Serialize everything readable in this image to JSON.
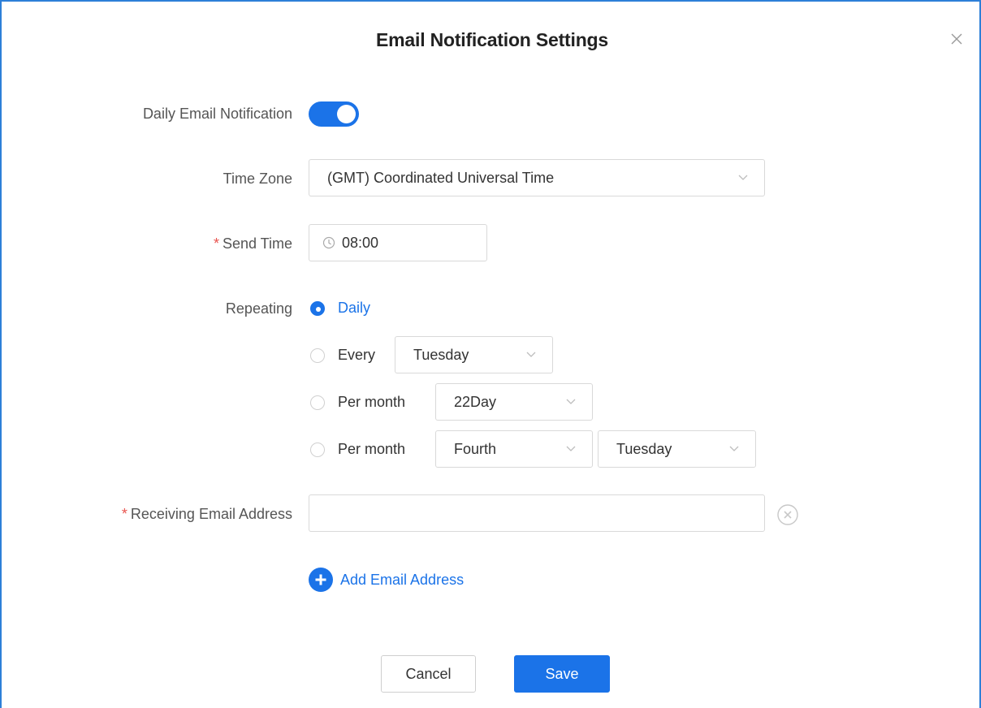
{
  "dialog": {
    "title": "Email Notification Settings",
    "close_icon": "close-icon"
  },
  "daily_notification": {
    "label": "Daily Email Notification",
    "enabled": true
  },
  "time_zone": {
    "label": "Time Zone",
    "value": "(GMT) Coordinated Universal Time"
  },
  "send_time": {
    "required_mark": "*",
    "label": "Send Time",
    "value": "08:00",
    "icon": "clock-icon"
  },
  "repeating": {
    "label": "Repeating",
    "options": [
      {
        "label": "Daily",
        "checked": true
      },
      {
        "label": "Every",
        "checked": false,
        "select": "Tuesday"
      },
      {
        "label": "Per month",
        "checked": false,
        "select": "22Day"
      },
      {
        "label": "Per month",
        "checked": false,
        "select": "Fourth",
        "select2": "Tuesday"
      }
    ]
  },
  "receiving_email": {
    "required_mark": "*",
    "label": "Receiving Email Address",
    "value": "",
    "remove_icon": "remove-circle-icon"
  },
  "add_email": {
    "label": "Add Email Address",
    "icon": "plus-circle-icon"
  },
  "buttons": {
    "cancel": "Cancel",
    "save": "Save"
  },
  "colors": {
    "accent": "#1b73e8",
    "border": "#2d7fd8",
    "required": "#e9544f"
  }
}
